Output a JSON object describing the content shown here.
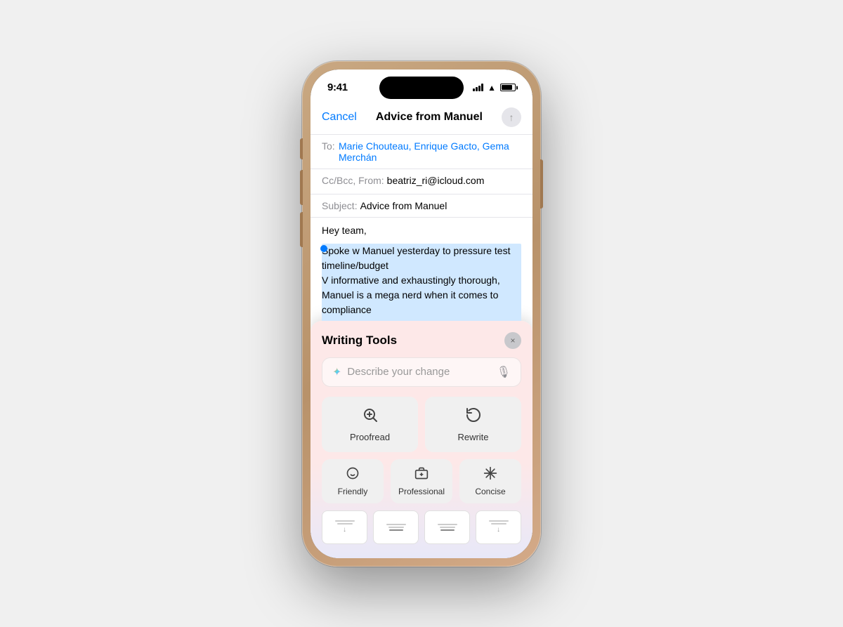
{
  "phone": {
    "status_bar": {
      "time": "9:41",
      "signal_label": "signal",
      "wifi_label": "wifi",
      "battery_label": "battery"
    }
  },
  "mail": {
    "header": {
      "cancel": "Cancel",
      "title": "Advice from Manuel",
      "send_icon": "↑"
    },
    "to_label": "To:",
    "to_value": "Marie Chouteau, Enrique Gacto, Gema Merchán",
    "cc_label": "Cc/Bcc, From:",
    "cc_value": "beatriz_ri@icloud.com",
    "subject_label": "Subject:",
    "subject_value": "Advice from Manuel",
    "body_greeting": "Hey team,",
    "body_selected": "Spoke w Manuel yesterday to pressure test timeline/budget\nV informative and exhaustingly thorough, Manuel is a mega nerd when it comes to compliance\nBig takeaway was timeline is realistic, we can commit with confidence, woo!\nM's firm specializes in community consultation, we need help here, should consider engaging th..."
  },
  "writing_tools": {
    "title": "Writing Tools",
    "close_label": "×",
    "input_placeholder": "Describe your change",
    "buttons_large": [
      {
        "id": "proofread",
        "icon": "🔍",
        "label": "Proofread"
      },
      {
        "id": "rewrite",
        "icon": "↻",
        "label": "Rewrite"
      }
    ],
    "buttons_small": [
      {
        "id": "friendly",
        "icon": "☺",
        "label": "Friendly"
      },
      {
        "id": "professional",
        "icon": "💼",
        "label": "Professional"
      },
      {
        "id": "concise",
        "icon": "✳",
        "label": "Concise"
      }
    ],
    "thumbnails": [
      {
        "id": "thumb1",
        "has_down_arrow": false
      },
      {
        "id": "thumb2",
        "has_line": true
      },
      {
        "id": "thumb3",
        "has_line": true
      },
      {
        "id": "thumb4",
        "has_down_arrow": true
      }
    ]
  }
}
